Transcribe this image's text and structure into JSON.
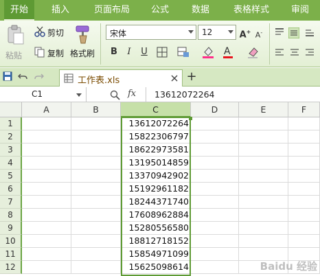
{
  "tabs": [
    "开始",
    "插入",
    "页面布局",
    "公式",
    "数据",
    "表格样式",
    "审阅"
  ],
  "clipboard": {
    "paste": "粘贴",
    "cut": "剪切",
    "copy": "复制",
    "format_painter": "格式刷"
  },
  "font": {
    "name": "宋体",
    "size": "12"
  },
  "format_buttons": {
    "bold": "B",
    "italic": "I",
    "underline": "U"
  },
  "document": {
    "tab_title": "工作表.xls",
    "new_tab": "+"
  },
  "formula_bar": {
    "name_box": "C1",
    "fx": "fx",
    "content": "13612072264"
  },
  "columns": [
    "A",
    "B",
    "C",
    "D",
    "E",
    "F"
  ],
  "selected_column": "C",
  "rows": [
    {
      "num": "1",
      "c": "13612072264"
    },
    {
      "num": "2",
      "c": "15822306797"
    },
    {
      "num": "3",
      "c": "18622973581"
    },
    {
      "num": "4",
      "c": "13195014859"
    },
    {
      "num": "5",
      "c": "13370942902"
    },
    {
      "num": "6",
      "c": "15192961182"
    },
    {
      "num": "7",
      "c": "18244371740"
    },
    {
      "num": "8",
      "c": "17608962884"
    },
    {
      "num": "9",
      "c": "15280556580"
    },
    {
      "num": "10",
      "c": "18812718152"
    },
    {
      "num": "11",
      "c": "15854971099"
    },
    {
      "num": "12",
      "c": "15625098614"
    }
  ],
  "watermark": "Baidu 经验",
  "colors": {
    "accent": "#7cb04a",
    "accent_dark": "#5e9a34",
    "selection": "#c6e0a8"
  }
}
